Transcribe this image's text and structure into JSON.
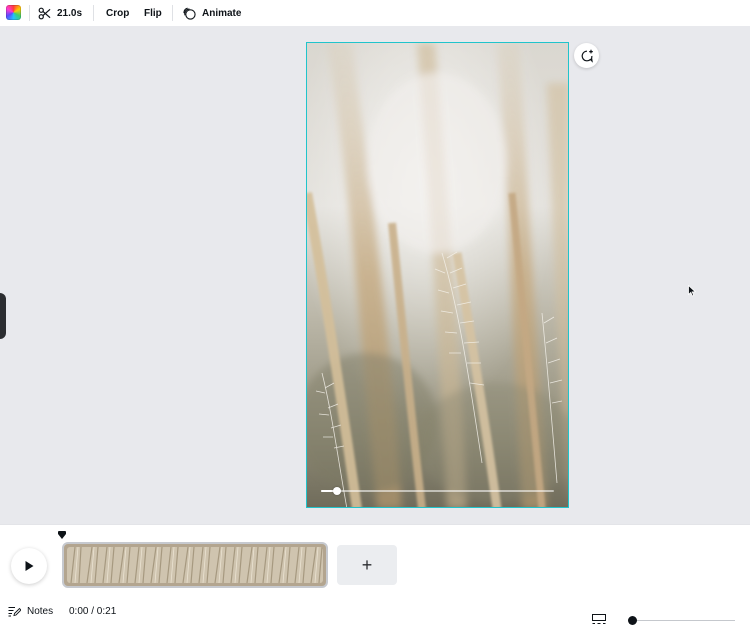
{
  "toolbar": {
    "duration_label": "21.0s",
    "crop_label": "Crop",
    "flip_label": "Flip",
    "animate_label": "Animate",
    "icons": {
      "color": "color-palette-icon",
      "trim": "scissors-icon",
      "animate": "animate-icon"
    }
  },
  "canvas": {
    "selection_color": "#20c4cb",
    "background_color": "#e8e9ed",
    "video_progress": 0.07,
    "icons": {
      "comment": "add-comment-icon",
      "cursor": "mouse-pointer-icon"
    }
  },
  "timeline": {
    "add_label": "+",
    "icons": {
      "play": "play-icon",
      "playhead": "playhead-marker-icon"
    }
  },
  "bottom_bar": {
    "notes_label": "Notes",
    "time_readout": "0:00 / 0:21",
    "zoom_level": 0.0,
    "icons": {
      "notes": "notes-icon",
      "grid_view": "grid-view-icon"
    }
  }
}
